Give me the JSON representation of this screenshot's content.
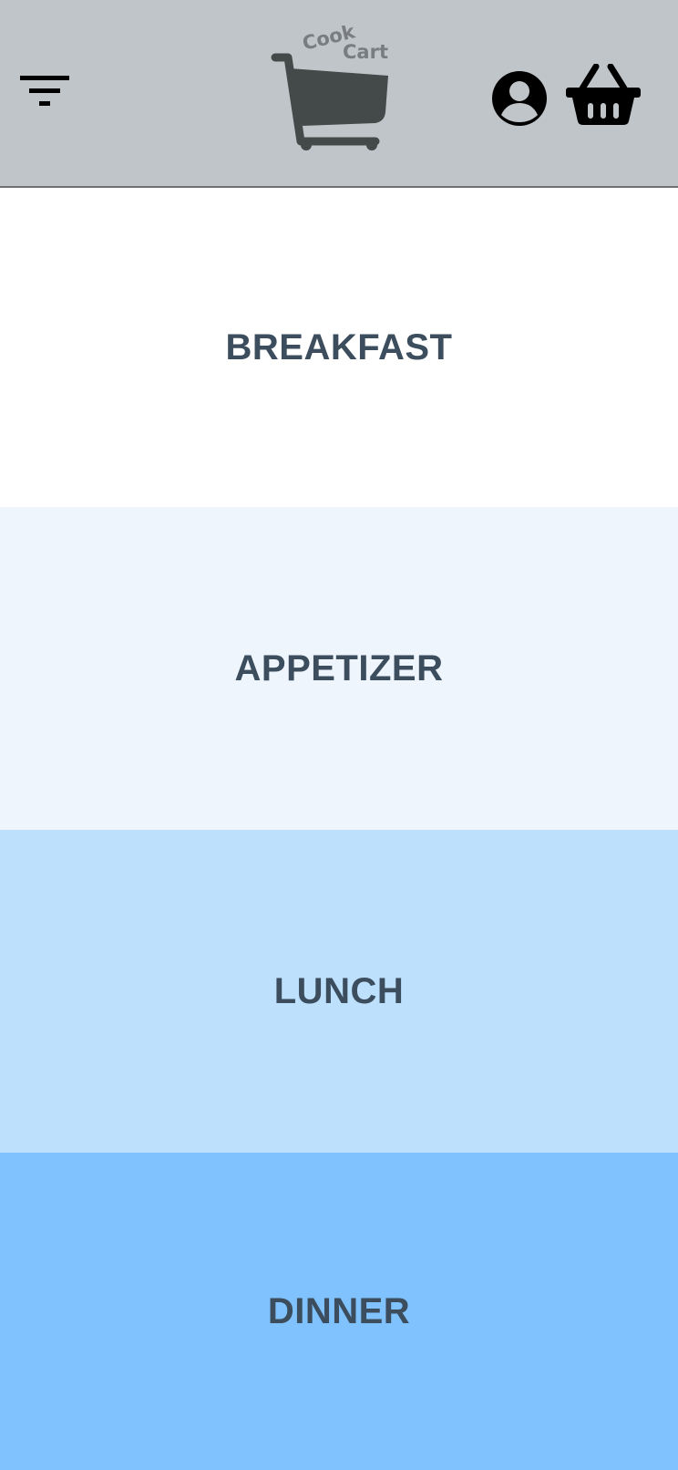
{
  "header": {
    "logo": {
      "word_top": "Cook",
      "word_bottom": "Cart",
      "icon": "shopping-cart-icon",
      "text_color": "#7a7d80",
      "cart_color": "#444949"
    },
    "filter_icon": "filter-icon",
    "profile_icon": "account-circle-icon",
    "basket_icon": "basket-icon",
    "background": "#c0c5c9"
  },
  "categories": [
    {
      "label": "BREAKFAST",
      "color": "#ffffff"
    },
    {
      "label": "APPETIZER",
      "color": "#eef5fd"
    },
    {
      "label": "LUNCH",
      "color": "#bde0fd"
    },
    {
      "label": "DINNER",
      "color": "#7fc2fe"
    }
  ]
}
